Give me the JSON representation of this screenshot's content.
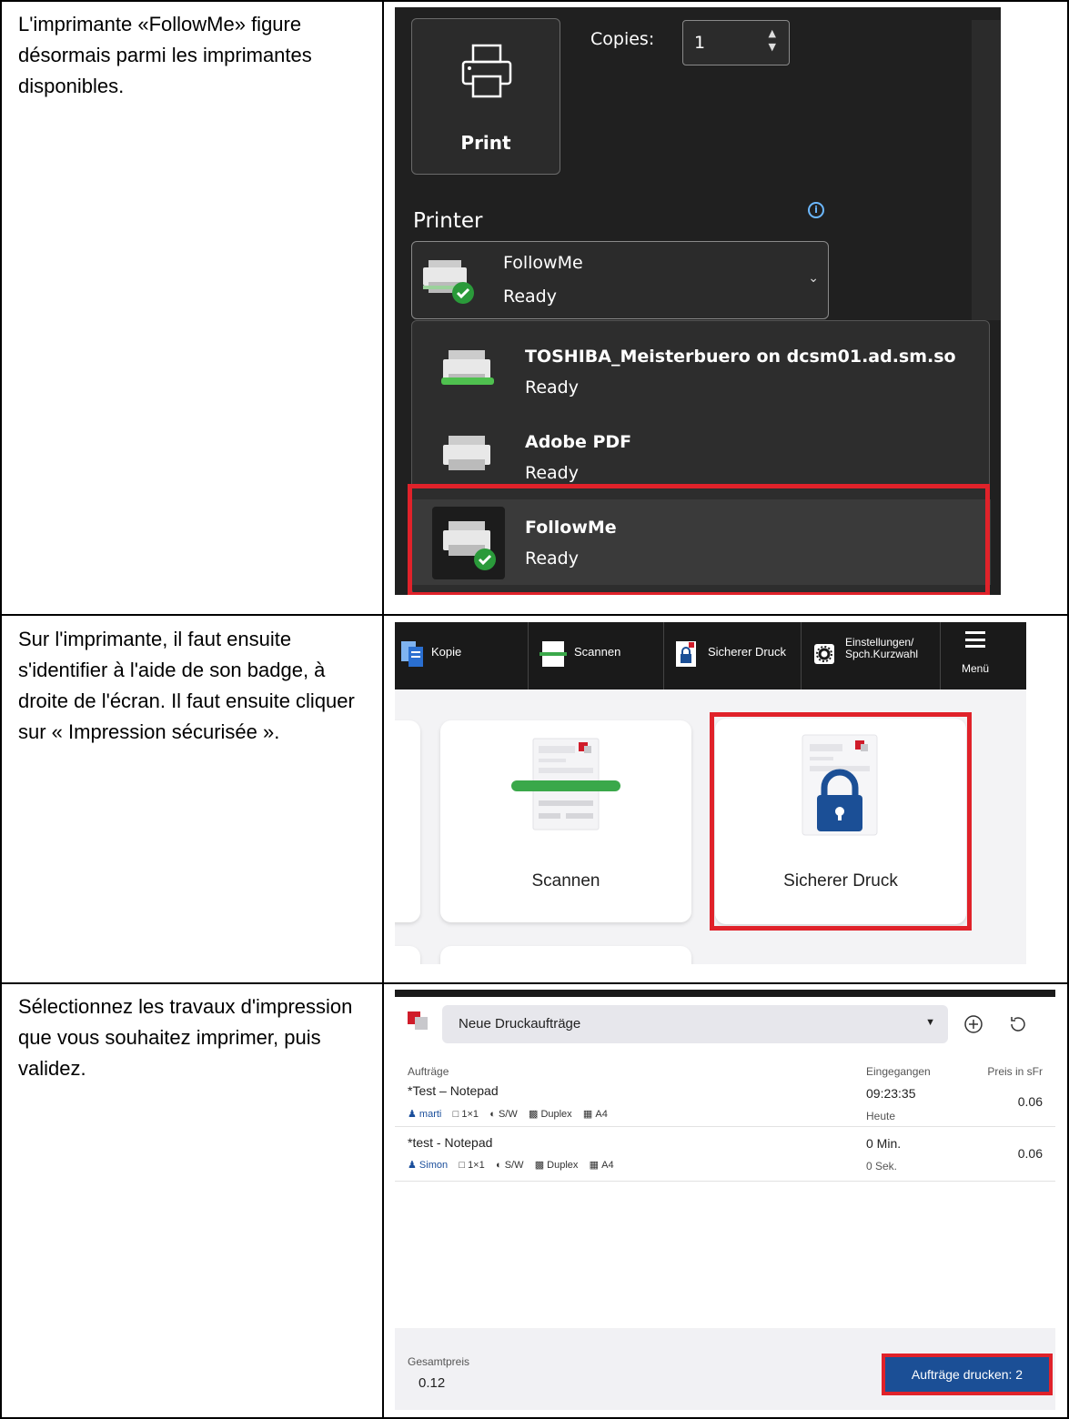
{
  "steps": [
    {
      "text": "L'imprimante «FollowMe» figure désormais parmi les imprimantes disponibles."
    },
    {
      "text": "Sur l'imprimante, il faut ensuite s'identifier à l'aide de son badge, à droite de l'écran. Il faut ensuite cliquer sur « Impression sécurisée »."
    },
    {
      "text": "Sélectionnez les travaux d'impression que vous souhaitez imprimer, puis validez."
    }
  ],
  "print_dialog": {
    "print_label": "Print",
    "copies_label": "Copies:",
    "copies_value": "1",
    "printer_heading": "Printer",
    "selected_printer": {
      "name": "FollowMe",
      "status": "Ready"
    },
    "printers": [
      {
        "name": "TOSHIBA_Meisterbuero on dcsm01.ad.sm.so",
        "status": "Ready"
      },
      {
        "name": "Adobe PDF",
        "status": "Ready"
      },
      {
        "name": "FollowMe",
        "status": "Ready"
      }
    ]
  },
  "printer_home": {
    "tabs": [
      {
        "label": "Kopie"
      },
      {
        "label": "Scannen"
      },
      {
        "label": "Sicherer Druck"
      },
      {
        "label": "Einstellungen/\nSpch.Kurzwahl"
      }
    ],
    "menu_label": "Menü",
    "cards": [
      {
        "label": "Scannen"
      },
      {
        "label": "Sicherer Druck"
      }
    ]
  },
  "job_list": {
    "queue_select": "Neue Druckaufträge",
    "col_jobs": "Aufträge",
    "col_received": "Eingegangen",
    "col_price": "Preis in sFr",
    "jobs": [
      {
        "title": "*Test – Notepad",
        "user": "marti",
        "pages": "1×1",
        "color": "S/W",
        "duplex": "Duplex",
        "paper": "A4",
        "received": "09:23:35",
        "received_sub": "Heute",
        "price": "0.06"
      },
      {
        "title": "*test - Notepad",
        "user": "Simon",
        "pages": "1×1",
        "color": "S/W",
        "duplex": "Duplex",
        "paper": "A4",
        "received": "0 Min.",
        "received_sub": "0 Sek.",
        "price": "0.06"
      }
    ],
    "total_label": "Gesamtpreis",
    "total_value": "0.12",
    "print_button": "Aufträge drucken: 2"
  },
  "colors": {
    "highlight": "#e0222a",
    "brand_blue": "#1b4f96",
    "dialog_bg": "#202020"
  }
}
